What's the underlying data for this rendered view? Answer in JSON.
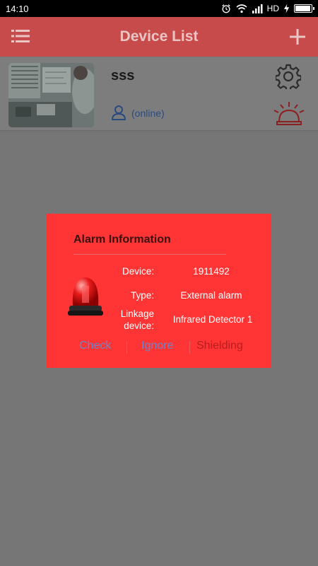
{
  "status_bar": {
    "time": "14:10",
    "network": "HD"
  },
  "header": {
    "title": "Device List"
  },
  "device": {
    "name": "sss",
    "status": "(online)"
  },
  "dialog": {
    "title": "Alarm Information",
    "labels": {
      "device": "Device:",
      "type": "Type:",
      "linkage_1": "Linkage",
      "linkage_2": "device:"
    },
    "values": {
      "device": "1911492",
      "type": "External alarm",
      "linkage": "Infrared Detector 1"
    },
    "actions": {
      "check": "Check",
      "ignore": "Ignore",
      "shielding": "Shielding"
    }
  },
  "icons": [
    "menu-icon",
    "add-icon",
    "gear-icon",
    "user-icon",
    "alarm-bell-icon",
    "siren-beacon-icon",
    "alarm-clock-icon",
    "wifi-icon",
    "signal-icon",
    "battery-icon"
  ],
  "colors": {
    "header": "#c84b4b",
    "dialog": "#ff3434",
    "action_link": "#6b86c7",
    "shielding": "#b81d1d",
    "overlay": "#767676"
  }
}
